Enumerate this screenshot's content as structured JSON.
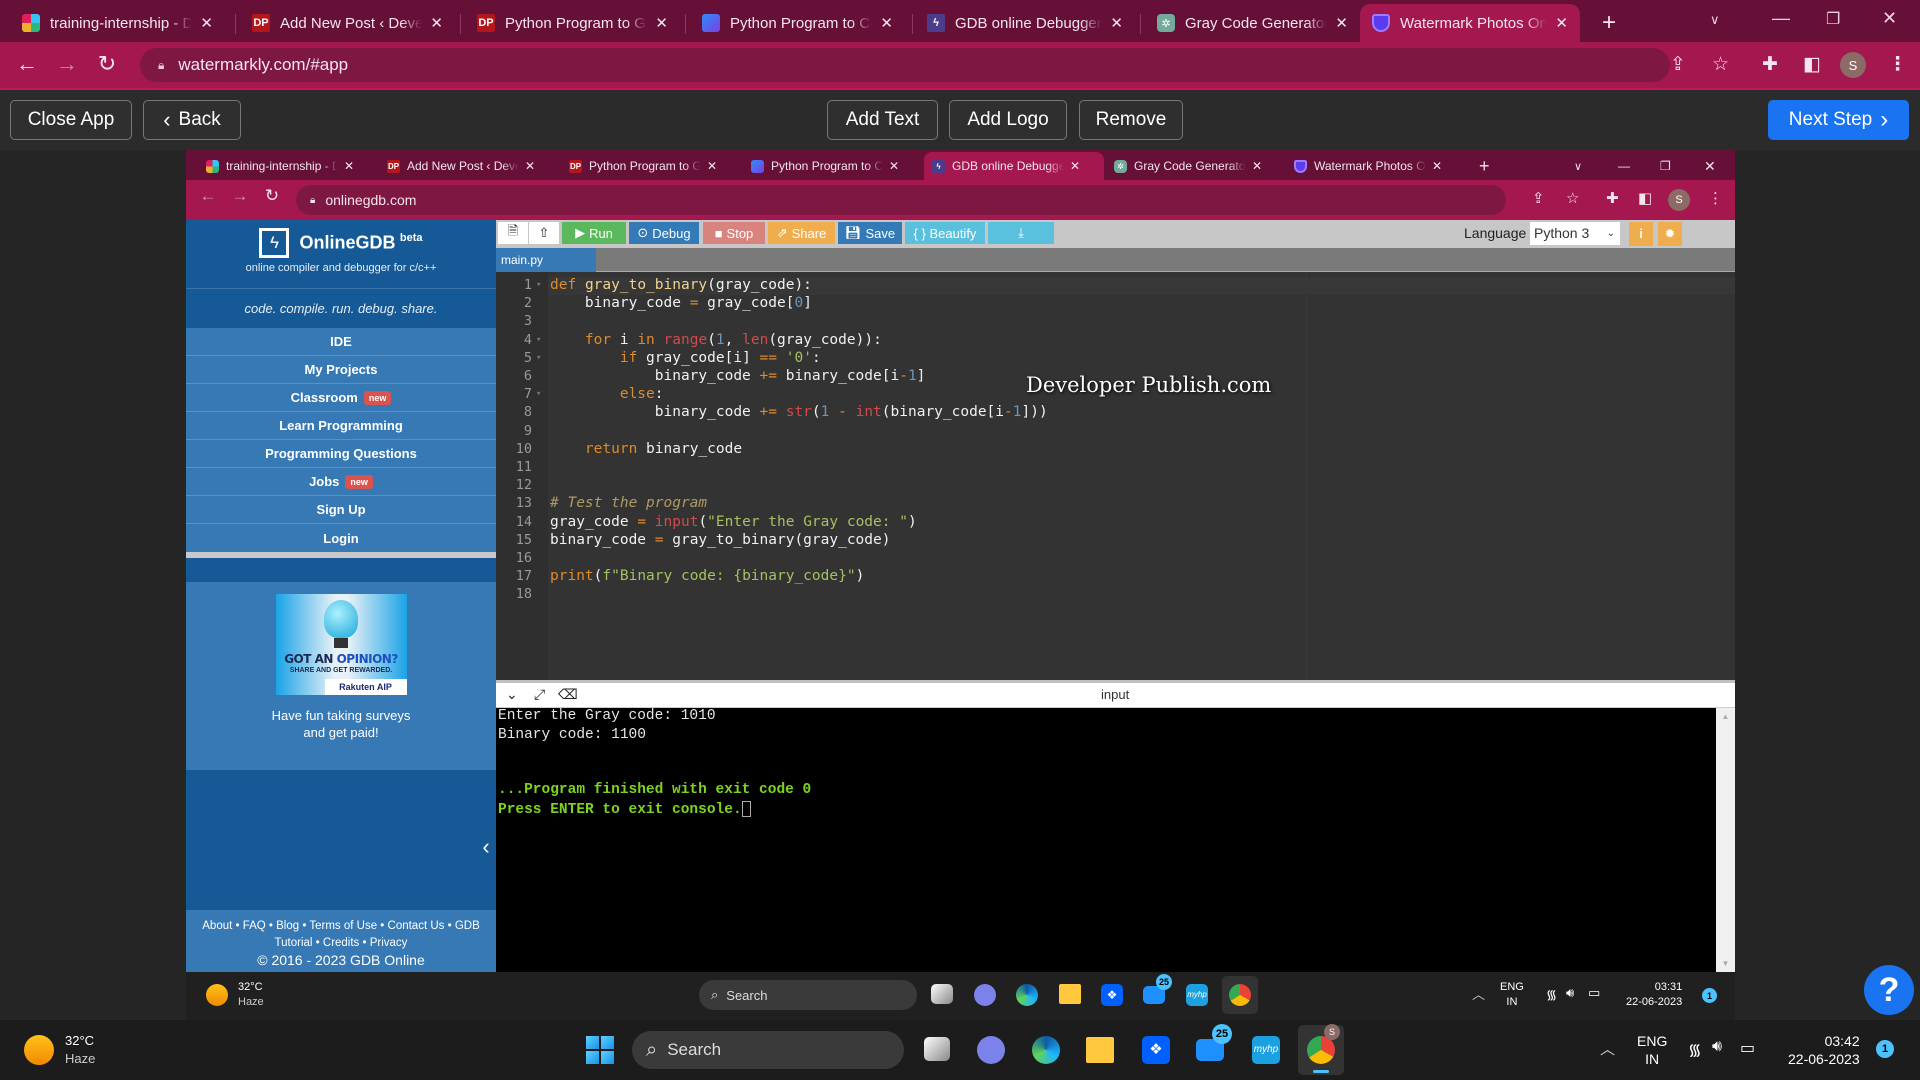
{
  "browser": {
    "tabs": [
      {
        "title": "training-internship - D",
        "favicon": "slack-icon"
      },
      {
        "title": "Add New Post ‹ Devel",
        "favicon": "dp-icon"
      },
      {
        "title": "Python Program to Ge",
        "favicon": "dp-icon"
      },
      {
        "title": "Python Program to Co",
        "favicon": "programiz-icon"
      },
      {
        "title": "GDB online Debugger",
        "favicon": "gdb-icon"
      },
      {
        "title": "Gray Code Generator.",
        "favicon": "chatgpt-icon"
      },
      {
        "title": "Watermark Photos On",
        "favicon": "watermarkly-icon",
        "active": true
      }
    ],
    "close_glyph": "✕",
    "new_tab_glyph": "+",
    "url": "watermarkly.com/#app",
    "profile_initial": "S"
  },
  "app": {
    "close_label": "Close App",
    "back_label": "Back",
    "add_text_label": "Add Text",
    "add_logo_label": "Add Logo",
    "remove_label": "Remove",
    "next_label": "Next Step",
    "accent_color": "#1a73f0"
  },
  "screenshot": {
    "browser": {
      "tabs": [
        {
          "title": "training-internship - D"
        },
        {
          "title": "Add New Post ‹ Devel"
        },
        {
          "title": "Python Program to Ge"
        },
        {
          "title": "Python Program to Co"
        },
        {
          "title": "GDB online Debugger",
          "active": true
        },
        {
          "title": "Gray Code Generator."
        },
        {
          "title": "Watermark Photos On"
        }
      ],
      "url": "onlinegdb.com",
      "profile_initial": "S"
    },
    "gdb": {
      "brand": "OnlineGDB",
      "brand_sup": "beta",
      "subtitle": "online compiler and debugger for c/c++",
      "tagline": "code. compile. run. debug. share.",
      "nav": [
        {
          "label": "IDE"
        },
        {
          "label": "My Projects"
        },
        {
          "label": "Classroom",
          "badge": "new"
        },
        {
          "label": "Learn Programming"
        },
        {
          "label": "Programming Questions"
        },
        {
          "label": "Jobs",
          "badge": "new"
        },
        {
          "label": "Sign Up"
        },
        {
          "label": "Login"
        }
      ],
      "ad": {
        "headline_a": "GOT AN ",
        "headline_b": "OPINION?",
        "subline": "SHARE AND GET REWARDED.",
        "sponsor": "Rakuten AIP",
        "text_line1": "Have fun taking surveys",
        "text_line2": "and get paid!"
      },
      "footer": {
        "links_line1": "About • FAQ • Blog • Terms of Use • Contact Us • GDB",
        "links_line2": "Tutorial • Credits • Privacy",
        "copyright": "© 2016 - 2023 GDB Online"
      },
      "toolbar": {
        "run": "Run",
        "debug": "Debug",
        "stop": "Stop",
        "share": "Share",
        "save": "Save",
        "beautify": "{ } Beautify",
        "language_label": "Language",
        "language_value": "Python 3"
      },
      "file_tab": "main.py",
      "code_lines": [
        "def gray_to_binary(gray_code):",
        "    binary_code = gray_code[0]",
        "",
        "    for i in range(1, len(gray_code)):",
        "        if gray_code[i] == '0':",
        "            binary_code += binary_code[i-1]",
        "        else:",
        "            binary_code += str(1 - int(binary_code[i-1]))",
        "",
        "    return binary_code",
        "",
        "",
        "# Test the program",
        "gray_code = input(\"Enter the Gray code: \")",
        "binary_code = gray_to_binary(gray_code)",
        "",
        "print(f\"Binary code: {binary_code}\")",
        ""
      ],
      "watermark_text": "Developer Publish.com",
      "console_title": "input",
      "console_lines": [
        "Enter the Gray code: 1010",
        "Binary code: 1100",
        "",
        "",
        "...Program finished with exit code 0",
        "Press ENTER to exit console."
      ]
    },
    "taskbar": {
      "weather_temp": "32°C",
      "weather_desc": "Haze",
      "search_label": "Search",
      "mail_badge": "25",
      "lang_line1": "ENG",
      "lang_line2": "IN",
      "time": "03:31",
      "date": "22-06-2023",
      "notification_count": "1"
    }
  },
  "taskbar": {
    "weather_temp": "32°C",
    "weather_desc": "Haze",
    "search_label": "Search",
    "mail_badge": "25",
    "lang_line1": "ENG",
    "lang_line2": "IN",
    "time": "03:42",
    "date": "22-06-2023",
    "notification_count": "1"
  },
  "help_glyph": "?"
}
